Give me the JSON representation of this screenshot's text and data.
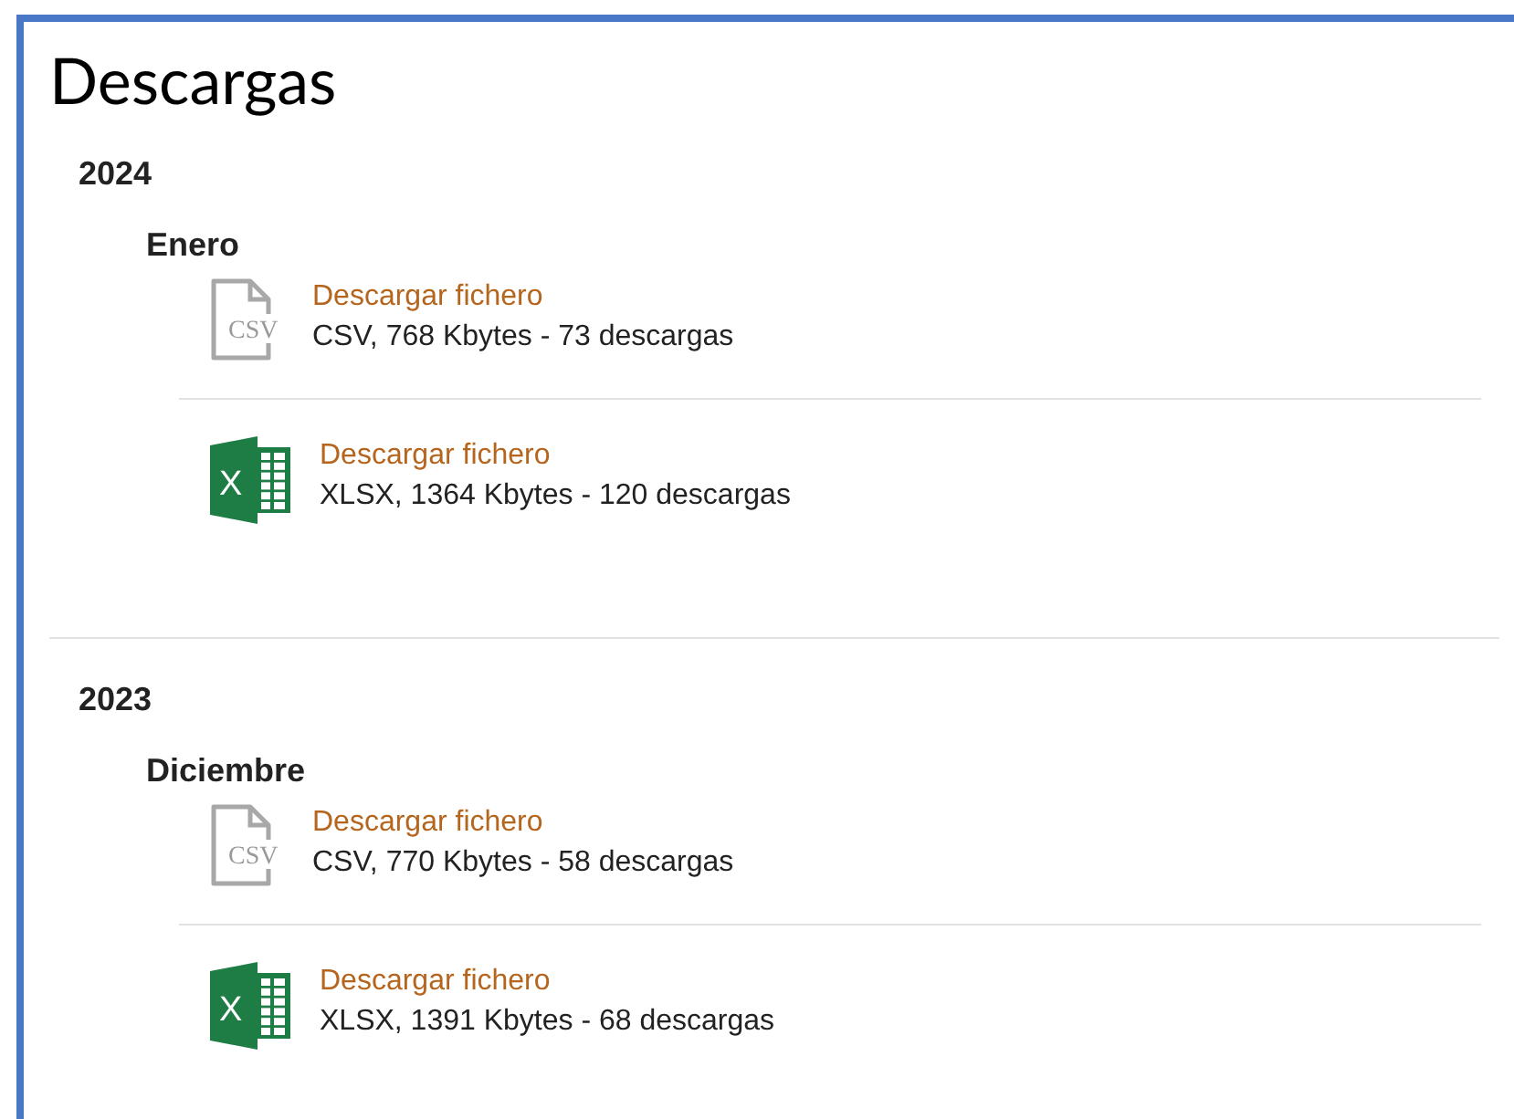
{
  "title": "Descargas",
  "years": [
    {
      "year": "2024",
      "months": [
        {
          "name": "Enero",
          "files": [
            {
              "kind": "csv",
              "icon_text": "CSV",
              "link": "Descargar fichero",
              "info": "CSV, 768 Kbytes - 73 descargas"
            },
            {
              "kind": "xlsx",
              "icon_text": "X",
              "link": "Descargar fichero",
              "info": "XLSX, 1364 Kbytes - 120 descargas"
            }
          ]
        }
      ]
    },
    {
      "year": "2023",
      "months": [
        {
          "name": "Diciembre",
          "files": [
            {
              "kind": "csv",
              "icon_text": "CSV",
              "link": "Descargar fichero",
              "info": "CSV, 770 Kbytes - 58 descargas"
            },
            {
              "kind": "xlsx",
              "icon_text": "X",
              "link": "Descargar fichero",
              "info": "XLSX, 1391 Kbytes - 68 descargas"
            }
          ]
        }
      ]
    }
  ]
}
